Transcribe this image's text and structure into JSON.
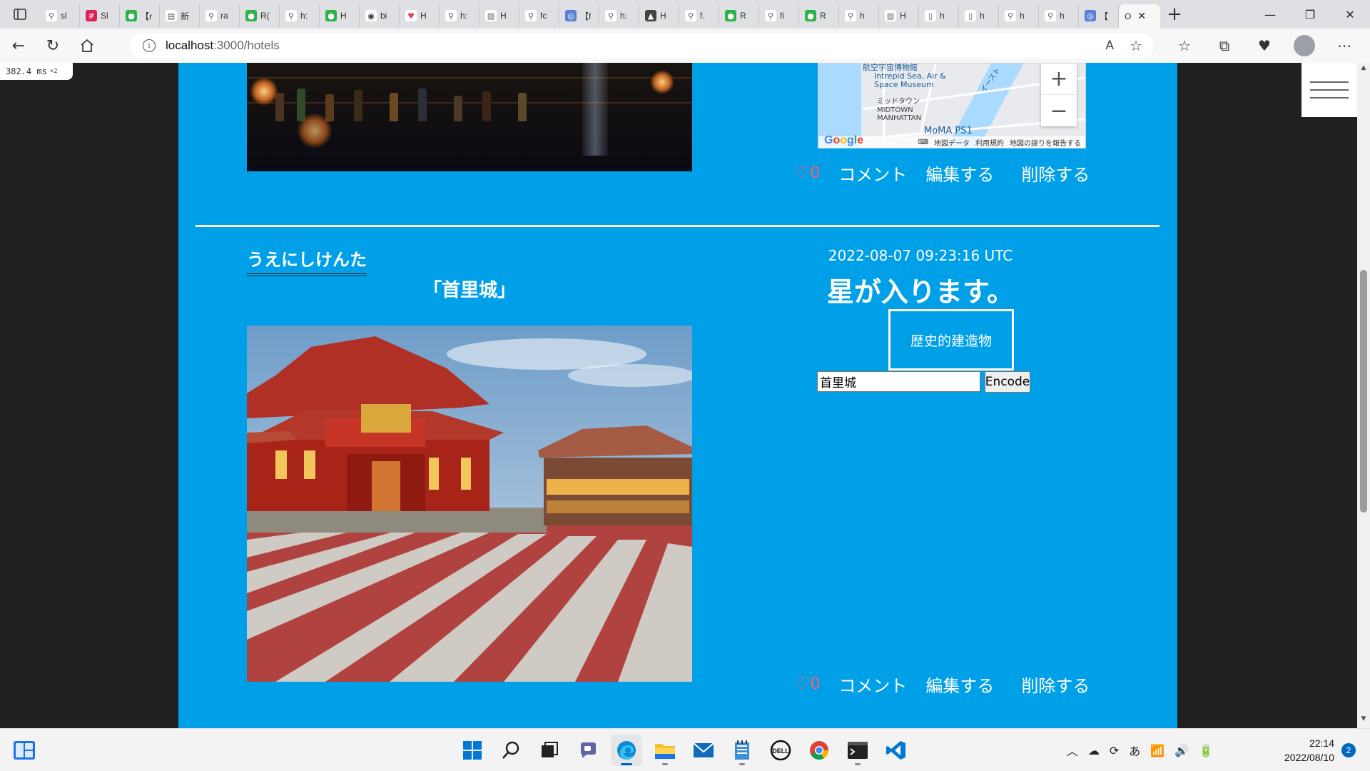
{
  "browser": {
    "tabs": [
      {
        "icon": "search-icon",
        "label": "sl"
      },
      {
        "icon": "slack-icon",
        "label": "Sl"
      },
      {
        "icon": "green-circle-icon",
        "label": "【r"
      },
      {
        "icon": "doc-icon",
        "label": "新"
      },
      {
        "icon": "search-icon",
        "label": "ra"
      },
      {
        "icon": "green-circle-icon",
        "label": "R("
      },
      {
        "icon": "search-icon",
        "label": "h:"
      },
      {
        "icon": "green-circle-icon",
        "label": "H"
      },
      {
        "icon": "github-icon",
        "label": "bi"
      },
      {
        "icon": "heart-icon",
        "label": "H"
      },
      {
        "icon": "search-icon",
        "label": "h:"
      },
      {
        "icon": "image-icon",
        "label": "H"
      },
      {
        "icon": "search-icon",
        "label": "fc"
      },
      {
        "icon": "qiita-icon",
        "label": "【f"
      },
      {
        "icon": "search-icon",
        "label": "h:"
      },
      {
        "icon": "triangle-icon",
        "label": "H"
      },
      {
        "icon": "search-icon",
        "label": "f."
      },
      {
        "icon": "green-circle-icon",
        "label": "R"
      },
      {
        "icon": "search-icon",
        "label": "fi"
      },
      {
        "icon": "green-circle-icon",
        "label": "R"
      },
      {
        "icon": "search-icon",
        "label": "h"
      },
      {
        "icon": "image-icon",
        "label": "H"
      },
      {
        "icon": "page-icon",
        "label": "h"
      },
      {
        "icon": "page-icon",
        "label": "h"
      },
      {
        "icon": "search-icon",
        "label": "h"
      },
      {
        "icon": "search-icon",
        "label": "h"
      },
      {
        "icon": "qiita-icon",
        "label": "【"
      }
    ],
    "active_tab": {
      "label": "O",
      "close": "✕"
    },
    "new_tab": "+",
    "window_controls": {
      "minimize": "—",
      "restore": "❐",
      "close": "✕"
    },
    "url_host": "localhost",
    "url_path": ":3000/hotels",
    "read_aloud": "A",
    "perf_value": "382.4 ms",
    "perf_mult": "×2"
  },
  "post1": {
    "map": {
      "labels": {
        "museum": "航空宇宙博物館",
        "intrepid": "Intrepid Sea, Air & Space Museum",
        "midtown_jp": "ミッドタウン",
        "midtown_en": "MIDTOWN MANHATTAN",
        "moma": "MoMA PS1",
        "street": "イースト"
      },
      "zoom_in": "+",
      "zoom_out": "−",
      "footer_data": "地図データ",
      "footer_terms": "利用規約",
      "footer_report": "地図の誤りを報告する",
      "google": [
        "G",
        "o",
        "o",
        "g",
        "l",
        "e"
      ]
    },
    "likes": "0",
    "comment": "コメント",
    "edit": "編集する",
    "delete": "削除する"
  },
  "post2": {
    "username": "うえにしけんた",
    "title": "「首里城」",
    "date": "2022-08-07 09:23:16 UTC",
    "rating": "星が入ります。",
    "tag": "歴史的建造物",
    "address_value": "首里城",
    "encode_label": "Encode",
    "likes": "0",
    "comment": "コメント",
    "edit": "編集する",
    "delete": "削除する"
  },
  "taskbar": {
    "apps": [
      "start",
      "search",
      "task-view",
      "chat",
      "edge",
      "explorer",
      "mail",
      "notepad",
      "dell",
      "chrome",
      "terminal",
      "vscode"
    ],
    "tray_lang": "あ",
    "time": "22:14",
    "date": "2022/08/10",
    "notifications": "2"
  },
  "colors": {
    "page_bg": "#00a0e9",
    "heart": "#ff5a6a",
    "accent": "#0067c0"
  }
}
